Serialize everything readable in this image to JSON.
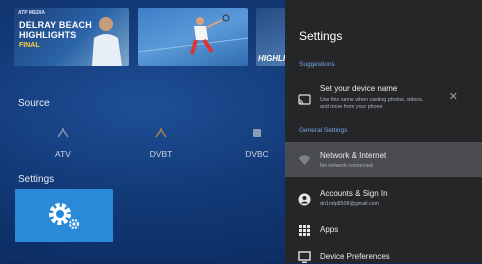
{
  "thumbnails": [
    {
      "brand": "ATP MEDIA",
      "title_line1": "DELRAY BEACH",
      "title_line2": "HIGHLIGHTS",
      "subtitle": "FINAL"
    },
    {},
    {
      "label": "HIGHLI"
    }
  ],
  "source": {
    "label": "Source",
    "items": [
      {
        "label": "ATV",
        "icon": "antenna-icon"
      },
      {
        "label": "DVBT",
        "icon": "antenna-icon"
      },
      {
        "label": "DVBC",
        "icon": "cable-icon"
      }
    ]
  },
  "settings_section": {
    "label": "Settings",
    "tile_icon": "gear-icon"
  },
  "panel": {
    "title": "Settings",
    "suggestions_label": "Suggestions",
    "suggestion": {
      "title": "Set your device name",
      "subtitle_line1": "Use this name when casting photos, videos,",
      "subtitle_line2": "and more from your phone",
      "icon": "cast-icon"
    },
    "general_label": "General Settings",
    "items": [
      {
        "title": "Network & Internet",
        "subtitle": "No network connected",
        "icon": "wifi-icon"
      },
      {
        "title": "Accounts & Sign In",
        "subtitle": "dn1ndp8508@gmail.com",
        "icon": "account-icon"
      },
      {
        "title": "Apps",
        "subtitle": "",
        "icon": "apps-icon"
      },
      {
        "title": "Device Preferences",
        "subtitle": "",
        "icon": "tv-icon"
      }
    ]
  },
  "colors": {
    "accent": "#2a8ad8",
    "panel_bg": "#242628",
    "section_label": "#79a6e8"
  }
}
